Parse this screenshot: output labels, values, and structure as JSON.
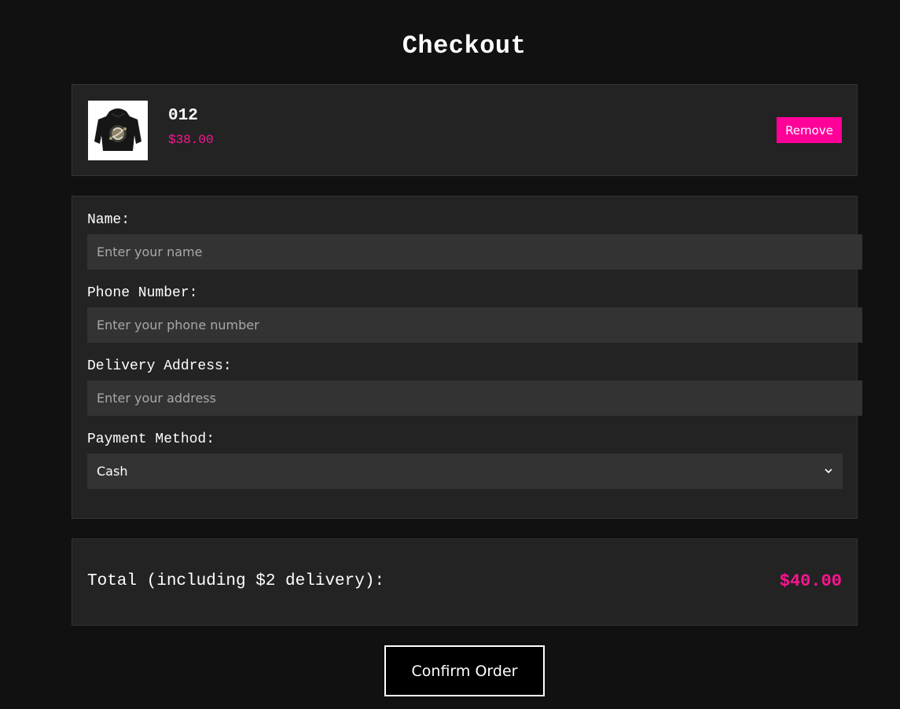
{
  "page": {
    "title": "Checkout"
  },
  "cart": {
    "items": [
      {
        "name": "012",
        "price": "$38.00",
        "image_icon": "hoodie-image",
        "remove_label": "Remove"
      }
    ]
  },
  "form": {
    "name": {
      "label": "Name:",
      "value": "",
      "placeholder": "Enter your name"
    },
    "phone": {
      "label": "Phone Number:",
      "value": "",
      "placeholder": "Enter your phone number"
    },
    "address": {
      "label": "Delivery Address:",
      "value": "",
      "placeholder": "Enter your address"
    },
    "payment": {
      "label": "Payment Method:",
      "selected": "Cash",
      "icon": "chevron-down-icon"
    }
  },
  "summary": {
    "total_label": "Total (including $2 delivery):",
    "total_value": "$40.00"
  },
  "actions": {
    "confirm_label": "Confirm Order"
  },
  "colors": {
    "background": "#111111",
    "card": "#232323",
    "input": "#333333",
    "accent": "#ff0099",
    "price": "#ff1493"
  }
}
